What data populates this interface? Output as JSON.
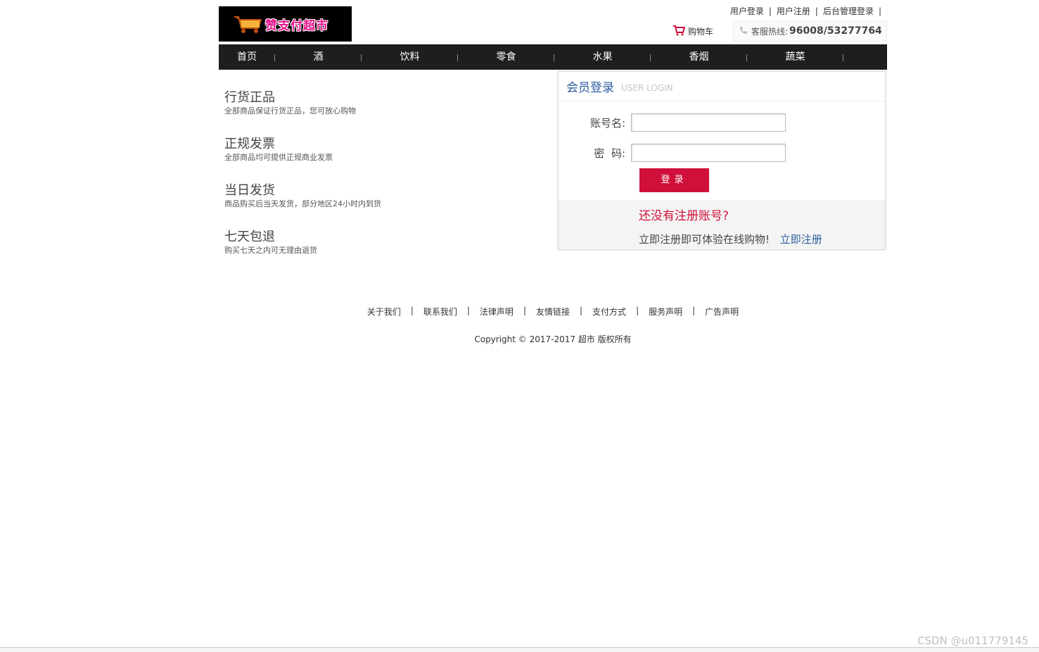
{
  "header": {
    "logo_text": "赞支付超市",
    "top_links": [
      "用户登录",
      "用户注册",
      "后台管理登录"
    ],
    "cart_label": "购物车",
    "hotline_label": "客服热线:",
    "hotline_number": "96008/53277764"
  },
  "nav": {
    "items": [
      "首页",
      "酒",
      "饮料",
      "零食",
      "水果",
      "香烟",
      "蔬菜"
    ]
  },
  "features": [
    {
      "title": "行货正品",
      "desc": "全部商品保证行货正品，您可放心购物"
    },
    {
      "title": "正规发票",
      "desc": "全部商品均可提供正规商业发票"
    },
    {
      "title": "当日发货",
      "desc": "商品购买后当天发货，部分地区24小时内到货"
    },
    {
      "title": "七天包退",
      "desc": "购买七天之内可无理由退货"
    }
  ],
  "login": {
    "title_cn": "会员登录",
    "title_en": "USER LOGIN",
    "account_label": "账号名:",
    "account_value": "",
    "password_label": "密  码:",
    "password_value": "",
    "submit_label": "登录",
    "register_question": "还没有注册账号?",
    "register_text": "立即注册即可体验在线购物!",
    "register_link": "立即注册"
  },
  "footer": {
    "links": [
      "关于我们",
      "联系我们",
      "法律声明",
      "友情链接",
      "支付方式",
      "服务声明",
      "广告声明"
    ],
    "copyright": "Copyright © 2017-2017 超市 版权所有"
  },
  "watermark": "CSDN @u011779145",
  "colors": {
    "nav_bg": "#1e1e1e",
    "accent_red": "#d0103a",
    "link_blue": "#2b5d9e"
  }
}
